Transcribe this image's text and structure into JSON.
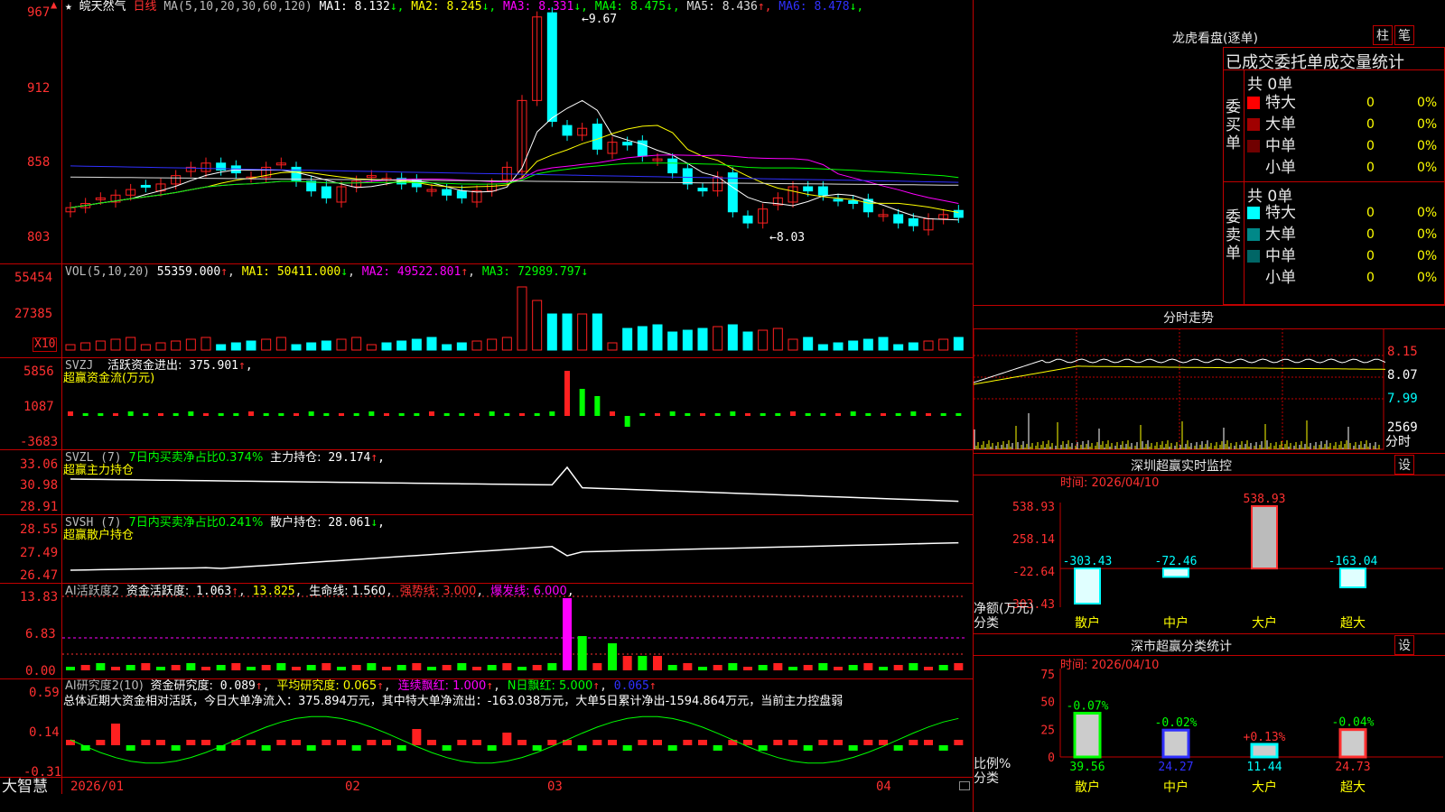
{
  "stock": {
    "name": "皖天然气",
    "period": "日线",
    "star": "★",
    "ma_label": "MA(5,10,20,30,60,120)",
    "ma": [
      {
        "label": "MA1:",
        "value": "8.132",
        "arrow": "↓",
        "color": "#ffffff"
      },
      {
        "label": "MA2:",
        "value": "8.245",
        "arrow": "↓",
        "color": "#ffff00"
      },
      {
        "label": "MA3:",
        "value": "8.331",
        "arrow": "↓",
        "color": "#ff00ff"
      },
      {
        "label": "MA4:",
        "value": "8.475",
        "arrow": "↓",
        "color": "#00ff00"
      },
      {
        "label": "MA5:",
        "value": "8.436",
        "arrow": "↑",
        "color": "#dddddd"
      },
      {
        "label": "MA6:",
        "value": "8.478",
        "arrow": "↓",
        "color": "#3030ff"
      }
    ],
    "high_mark": "9.67",
    "low_mark": "8.03",
    "price_axis": [
      "967",
      "912",
      "858",
      "803"
    ]
  },
  "vol": {
    "label": "VOL(5,10,20)",
    "value": "55359.000",
    "arrow": "↑",
    "ma1": "MA1: 50411.000",
    "ma1_arrow": "↓",
    "ma2": "MA2: 49522.801",
    "ma2_arrow": "↑",
    "ma3": "MA3: 72989.797",
    "ma3_arrow": "↓",
    "axis": [
      "55454",
      "27385"
    ],
    "unit": "X10"
  },
  "svzj": {
    "label": "SVZJ",
    "name": "活跃资金进出:",
    "value": "375.901",
    "arrow": "↑",
    "tail": ",",
    "sub": "超赢资金流(万元)",
    "axis": [
      "5856",
      "1087",
      "-3683"
    ]
  },
  "svzl": {
    "label": "SVZL (7)",
    "desc": "7日内买卖净占比0.374%",
    "name": "主力持仓:",
    "value": "29.174",
    "arrow": "↑",
    "tail": ",",
    "sub": "超赢主力持仓",
    "axis": [
      "33.06",
      "30.98",
      "28.91"
    ]
  },
  "svsh": {
    "label": "SVSH (7)",
    "desc": "7日内买卖净占比0.241%",
    "name": "散户持仓:",
    "value": "28.061",
    "arrow": "↓",
    "tail": ",",
    "sub": "超赢散户持仓",
    "axis": [
      "28.55",
      "27.49",
      "26.47"
    ]
  },
  "ai1": {
    "label": "AI活跃度2",
    "name": "资金活跃度:",
    "value": "1.063",
    "arrow": "↑",
    "v2": "13.825",
    "life": "生命线: 1.560",
    "strong": "强势线: 3.000",
    "burst": "爆发线: 6.000",
    "tail": ",",
    "axis": [
      "13.83",
      "6.83",
      "0.00"
    ]
  },
  "ai2": {
    "label": "AI研究度2(10)",
    "name": "资金研究度:",
    "value": "0.089",
    "arrow": "↑",
    "avg": "平均研究度: 0.065",
    "avg_arrow": "↑",
    "lianxu": "连续飘红: 1.000",
    "lianxu_arrow": "↑",
    "nday": "N日飘红: 5.000",
    "nday_arrow": "↑",
    "last": "0.065",
    "last_arrow": "↑",
    "summary": "总体近期大资金相对活跃，今日大单净流入：375.894万元，其中特大单净流出：-163.038万元，大单5日累计净出-1594.864万元，当前主力控盘弱",
    "axis": [
      "0.59",
      "0.14",
      "-0.31"
    ]
  },
  "xaxis": {
    "brand": "大智慧",
    "labels": [
      "2026/01",
      "02",
      "03",
      "04"
    ]
  },
  "lhb": {
    "title": "龙虎看盘(逐单)",
    "btn_zhu": "柱",
    "btn_bi": "笔",
    "header": "已成交委托单成交量统计",
    "buy_total": "共 0单",
    "buy_side": "委买单",
    "sell_total": "共 0单",
    "sell_side": "委卖单",
    "buy_rows": [
      {
        "name": "特大",
        "count": "0",
        "pct": "0%",
        "color": "#ff0000"
      },
      {
        "name": "大单",
        "count": "0",
        "pct": "0%",
        "color": "#a00000"
      },
      {
        "name": "中单",
        "count": "0",
        "pct": "0%",
        "color": "#700000"
      },
      {
        "name": "小单",
        "count": "0",
        "pct": "0%",
        "color": "#000000"
      }
    ],
    "sell_rows": [
      {
        "name": "特大",
        "count": "0",
        "pct": "0%",
        "color": "#00ffff"
      },
      {
        "name": "大单",
        "count": "0",
        "pct": "0%",
        "color": "#008888"
      },
      {
        "name": "中单",
        "count": "0",
        "pct": "0%",
        "color": "#006666"
      },
      {
        "name": "小单",
        "count": "0",
        "pct": "0%",
        "color": "#000000"
      }
    ]
  },
  "fenshi": {
    "title": "分时走势",
    "axis": [
      "8.15",
      "8.07",
      "7.99"
    ],
    "vol_axis": "2569",
    "vol_unit": "分时"
  },
  "sz_monitor": {
    "title": "深圳超赢实时监控",
    "btn": "设",
    "time": "时间: 2026/04/10",
    "axis": [
      "538.93",
      "258.14",
      "-22.64",
      "-303.43"
    ],
    "ylabel1": "净额(万元)",
    "ylabel2": "分类",
    "categories": [
      "散户",
      "中户",
      "大户",
      "超大"
    ],
    "values": [
      -303.43,
      -72.46,
      538.93,
      -163.04
    ],
    "value_labels": [
      "-303.43",
      "-72.46",
      "538.93",
      "-163.04"
    ]
  },
  "sz_class": {
    "title": "深市超赢分类统计",
    "btn": "设",
    "time": "时间: 2026/04/10",
    "axis": [
      "75",
      "50",
      "25",
      "0"
    ],
    "ylabel1": "比例%",
    "ylabel2": "分类",
    "categories": [
      "散户",
      "中户",
      "大户",
      "超大"
    ],
    "values": [
      39.56,
      24.27,
      11.44,
      24.73
    ],
    "changes": [
      "-0.07%",
      "-0.02%",
      "+0.13%",
      "-0.04%"
    ]
  },
  "chart_data": [
    {
      "type": "bar",
      "title": "深圳超赢实时监控",
      "categories": [
        "散户",
        "中户",
        "大户",
        "超大"
      ],
      "values": [
        -303.43,
        -72.46,
        538.93,
        -163.04
      ],
      "ylabel": "净额(万元)",
      "ylim": [
        -303.43,
        538.93
      ]
    },
    {
      "type": "bar",
      "title": "深市超赢分类统计",
      "categories": [
        "散户",
        "中户",
        "大户",
        "超大"
      ],
      "values": [
        39.56,
        24.27,
        11.44,
        24.73
      ],
      "ylabel": "比例%",
      "ylim": [
        0,
        75
      ]
    }
  ],
  "colors": {
    "up": "#ff2020",
    "down": "#00ffff",
    "grid": "#c00000",
    "accent_yellow": "#ffff00"
  }
}
